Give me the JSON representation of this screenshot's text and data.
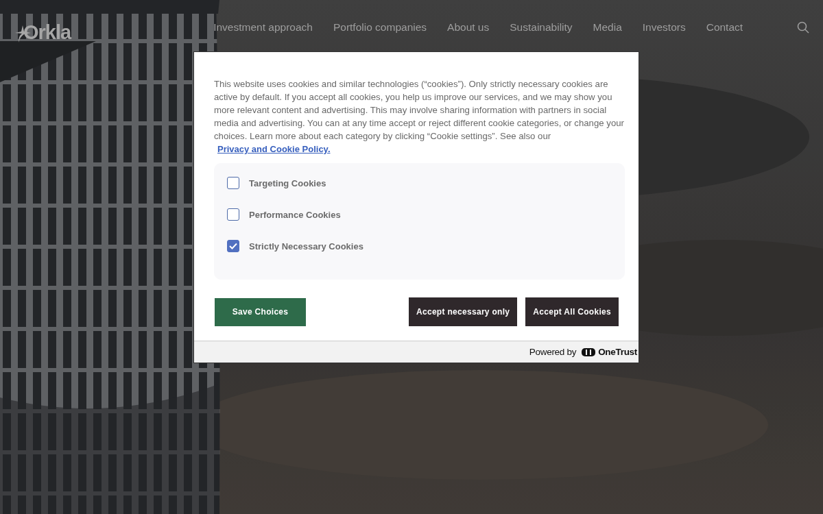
{
  "header": {
    "logo": "Orkla",
    "nav": [
      {
        "label": "Investment approach"
      },
      {
        "label": "Portfolio companies"
      },
      {
        "label": "About us"
      },
      {
        "label": "Sustainability"
      },
      {
        "label": "Media"
      },
      {
        "label": "Investors"
      },
      {
        "label": "Contact"
      }
    ]
  },
  "cookie_banner": {
    "text": "This website uses cookies and similar technologies (“cookies”). Only strictly necessary cookies are active by default. If you accept all cookies, you help us improve our services, and we may show you more relevant content and advertising. This may involve sharing information with partners in social media and advertising. You can at any time accept or reject different cookie categories, or change your choices. Learn more about each category by clicking “Cookie settings”. See also our",
    "policy_link": "Privacy and Cookie Policy.",
    "categories": [
      {
        "label": "Targeting Cookies",
        "checked": false
      },
      {
        "label": "Performance Cookies",
        "checked": false
      },
      {
        "label": "Strictly Necessary Cookies",
        "checked": true
      }
    ],
    "buttons": [
      {
        "label": "Save Choices",
        "kind": "save"
      },
      {
        "label": "Accept necessary only",
        "kind": "dark"
      },
      {
        "label": "Accept All Cookies",
        "kind": "dark"
      }
    ],
    "footer": {
      "powered_by": "Powered by",
      "brand": "OneTrust"
    }
  }
}
